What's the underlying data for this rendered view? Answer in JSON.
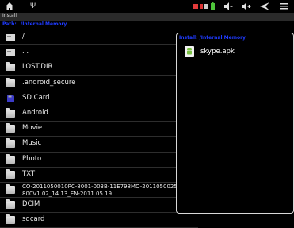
{
  "status": {
    "usb_symbol": "Ψ",
    "icons": [
      "home-icon",
      "usb-icon",
      "wifi-icon",
      "battery-icon",
      "volume-down-icon",
      "volume-up-icon",
      "back-icon",
      "menu-icon"
    ]
  },
  "title": "Install",
  "path": {
    "label": "Path:",
    "value": "/Internal Memory"
  },
  "files": [
    {
      "name": "/",
      "icon": "drive-icon"
    },
    {
      "name": ". .",
      "icon": "drive-icon"
    },
    {
      "name": "LOST.DIR",
      "icon": "folder-icon"
    },
    {
      "name": ".android_secure",
      "icon": "folder-icon"
    },
    {
      "name": "SD Card",
      "icon": "sdcard-icon"
    },
    {
      "name": "Android",
      "icon": "folder-icon"
    },
    {
      "name": "Movie",
      "icon": "folder-icon"
    },
    {
      "name": "Music",
      "icon": "folder-icon"
    },
    {
      "name": "Photo",
      "icon": "folder-icon"
    },
    {
      "name": "TXT",
      "icon": "folder-icon"
    },
    {
      "name": "CO-2011050010PC-8001-003B-11E798MO-2011050025 800V1.02_14.13_EN-2011.05.19",
      "icon": "folder-icon"
    },
    {
      "name": "DCIM",
      "icon": "folder-icon"
    },
    {
      "name": "sdcard",
      "icon": "folder-icon"
    }
  ],
  "apk_panel": {
    "header": "Install:  /Internal Memory",
    "items": [
      {
        "name": "skype.apk",
        "icon": "apk-icon"
      }
    ]
  },
  "colors": {
    "accent": "#1f3bff",
    "background": "#000000"
  }
}
